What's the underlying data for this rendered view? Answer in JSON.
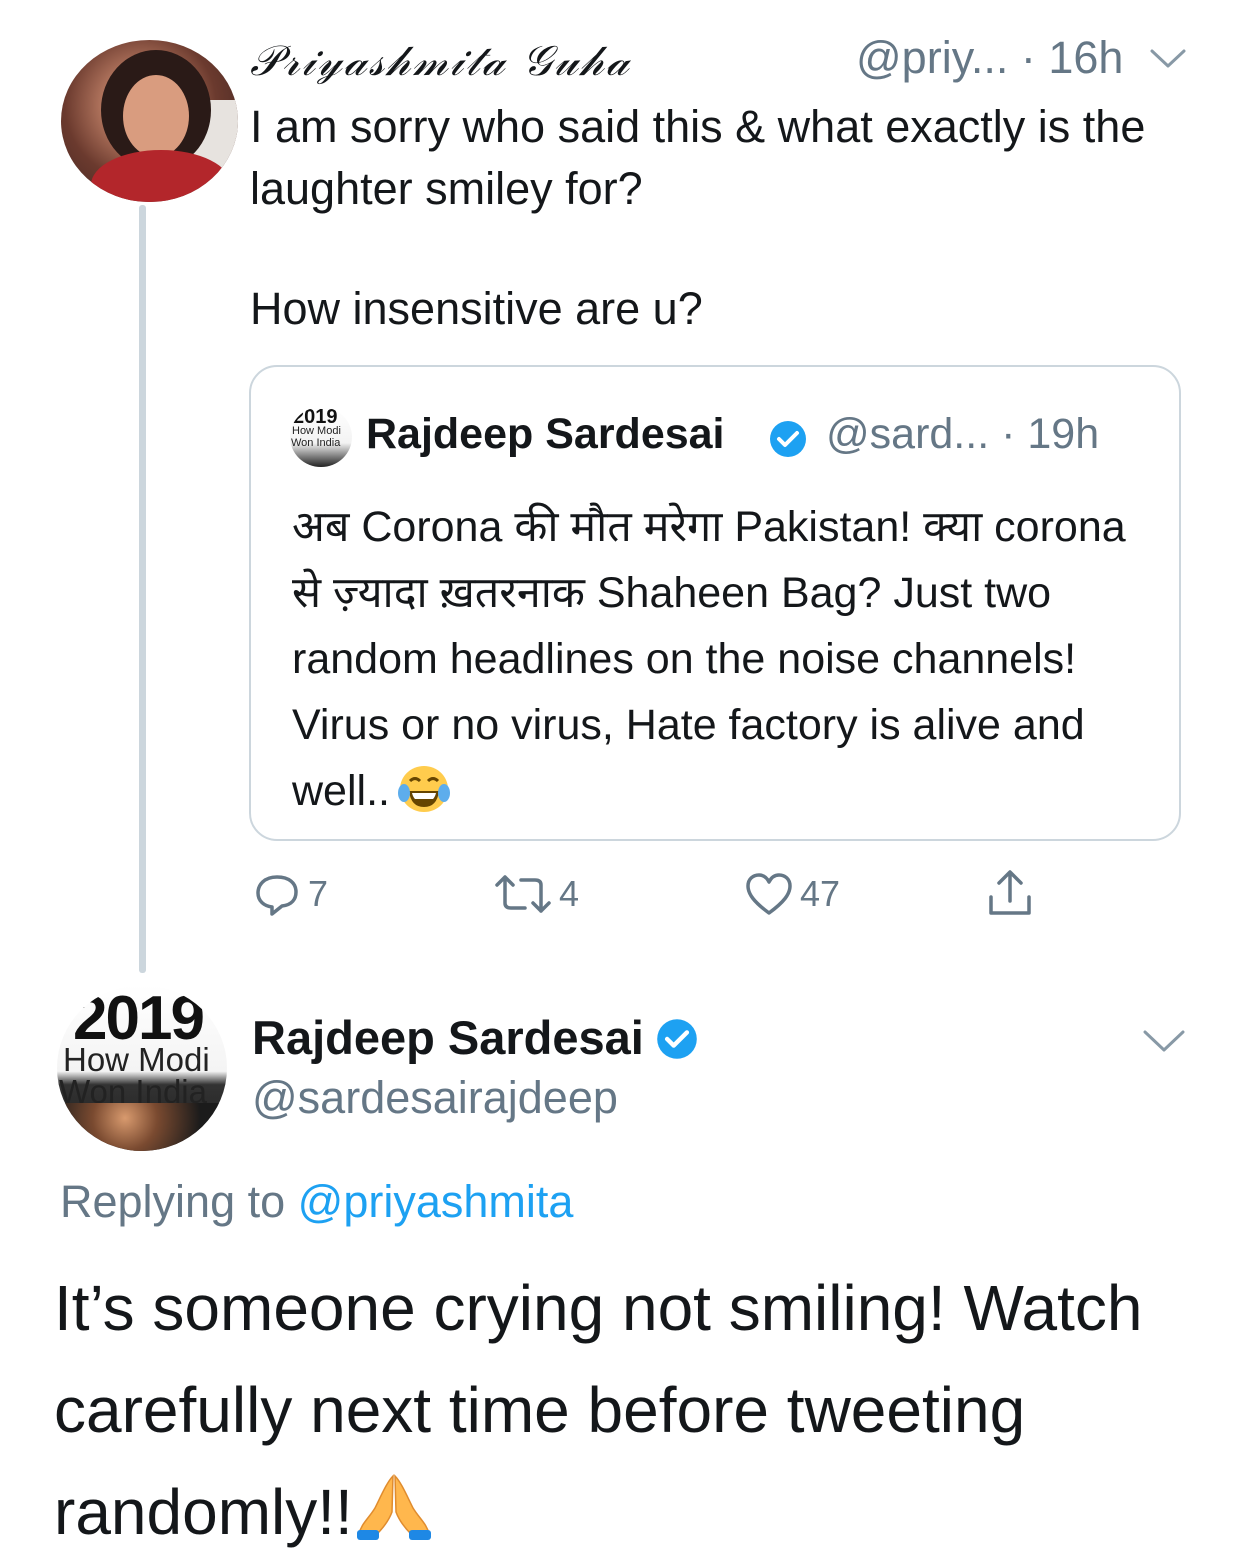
{
  "tweet": {
    "display_name": "𝒫𝓇𝒾𝓎𝒶𝓈𝒽𝓂𝒾𝓉𝒶 𝒢𝓊𝒽𝒶",
    "handle": "@priy...",
    "time": "· 16h",
    "text_line1": "I am sorry who said this & what exactly is the laughter smiley for?",
    "text_line2": "How insensitive are u?"
  },
  "quoted_tweet": {
    "avatar_year": "2019",
    "avatar_line1": "How Modi",
    "avatar_line2": "Won India",
    "display_name": "Rajdeep Sardesai",
    "handle": "@sard...",
    "time": "· 19h",
    "text": "अब Corona की मौत मरेगा Pakistan! क्या corona से ज़्यादा ख़तरनाक Shaheen Bag? Just two random headlines on the noise channels! Virus or no virus, Hate factory is alive and well..",
    "emoji": "face-with-tears-of-joy"
  },
  "actions": {
    "reply_count": "7",
    "retweet_count": "4",
    "like_count": "47"
  },
  "reply": {
    "avatar_year": "2019",
    "avatar_line1": "How Modi",
    "avatar_line2": "Won India",
    "display_name": "Rajdeep Sardesai",
    "handle": "@sardesairajdeep",
    "replying_to_label": "Replying to",
    "replying_to_handle": "@priyashmita",
    "text": "It’s someone crying not smiling! Watch carefully next time before tweeting randomly!!",
    "emoji": "folded-hands"
  },
  "colors": {
    "text": "#14171a",
    "secondary": "#657786",
    "link": "#1da1f2",
    "verified": "#1da1f2",
    "border": "#ccd6dd"
  }
}
